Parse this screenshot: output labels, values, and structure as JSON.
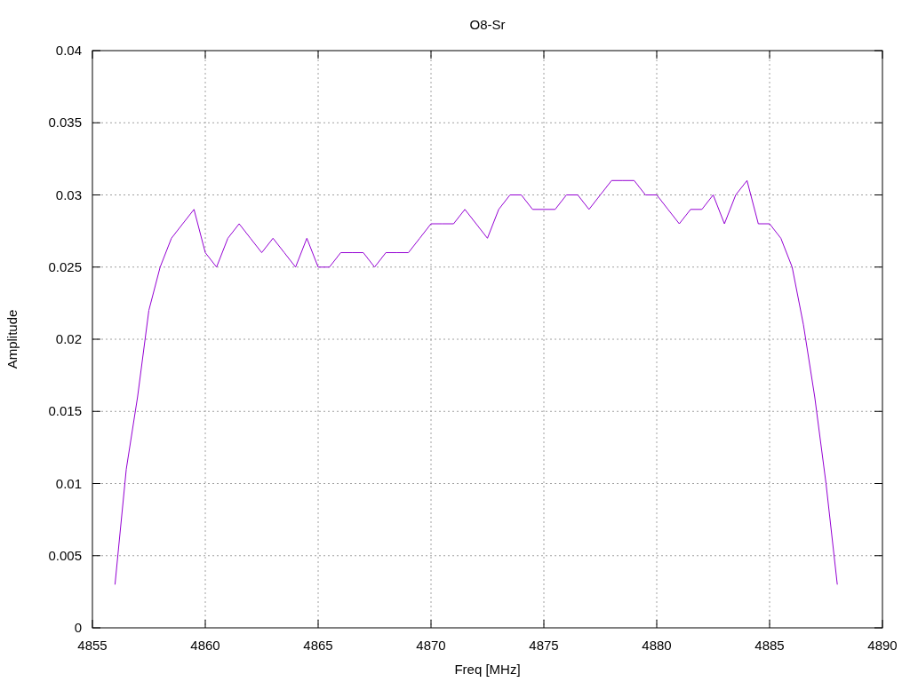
{
  "chart_data": {
    "type": "line",
    "title": "O8-Sr",
    "xlabel": "Freq [MHz]",
    "ylabel": "Amplitude",
    "x": [
      4856,
      4856.5,
      4857,
      4857.5,
      4858,
      4858.5,
      4859,
      4859.5,
      4860,
      4860.5,
      4861,
      4861.5,
      4862,
      4862.5,
      4863,
      4863.5,
      4864,
      4864.5,
      4865,
      4865.5,
      4866,
      4866.5,
      4867,
      4867.5,
      4868,
      4868.5,
      4869,
      4869.5,
      4870,
      4870.5,
      4871,
      4871.5,
      4872,
      4872.5,
      4873,
      4873.5,
      4874,
      4874.5,
      4875,
      4875.5,
      4876,
      4876.5,
      4877,
      4877.5,
      4878,
      4878.5,
      4879,
      4879.5,
      4880,
      4880.5,
      4881,
      4881.5,
      4882,
      4882.5,
      4883,
      4883.5,
      4884,
      4884.5,
      4885,
      4885.5,
      4886,
      4886.5,
      4887,
      4887.5,
      4888
    ],
    "series": [
      {
        "color": "#9400d3",
        "values": [
          0.003,
          0.011,
          0.016,
          0.022,
          0.025,
          0.027,
          0.028,
          0.029,
          0.026,
          0.025,
          0.027,
          0.028,
          0.027,
          0.026,
          0.027,
          0.026,
          0.025,
          0.027,
          0.025,
          0.025,
          0.026,
          0.026,
          0.026,
          0.025,
          0.026,
          0.026,
          0.026,
          0.027,
          0.028,
          0.028,
          0.028,
          0.029,
          0.028,
          0.027,
          0.029,
          0.03,
          0.03,
          0.029,
          0.029,
          0.029,
          0.03,
          0.03,
          0.029,
          0.03,
          0.031,
          0.031,
          0.031,
          0.03,
          0.03,
          0.029,
          0.028,
          0.029,
          0.029,
          0.03,
          0.028,
          0.03,
          0.031,
          0.028,
          0.028,
          0.027,
          0.025,
          0.021,
          0.016,
          0.01,
          0.003
        ]
      }
    ],
    "grid": true,
    "xlim": [
      4855,
      4890
    ],
    "ylim": [
      0,
      0.04
    ],
    "xticks": [
      4855,
      4860,
      4865,
      4870,
      4875,
      4880,
      4885,
      4890
    ],
    "yticks": [
      0,
      0.005,
      0.01,
      0.015,
      0.02,
      0.025,
      0.03,
      0.035,
      0.04
    ]
  }
}
